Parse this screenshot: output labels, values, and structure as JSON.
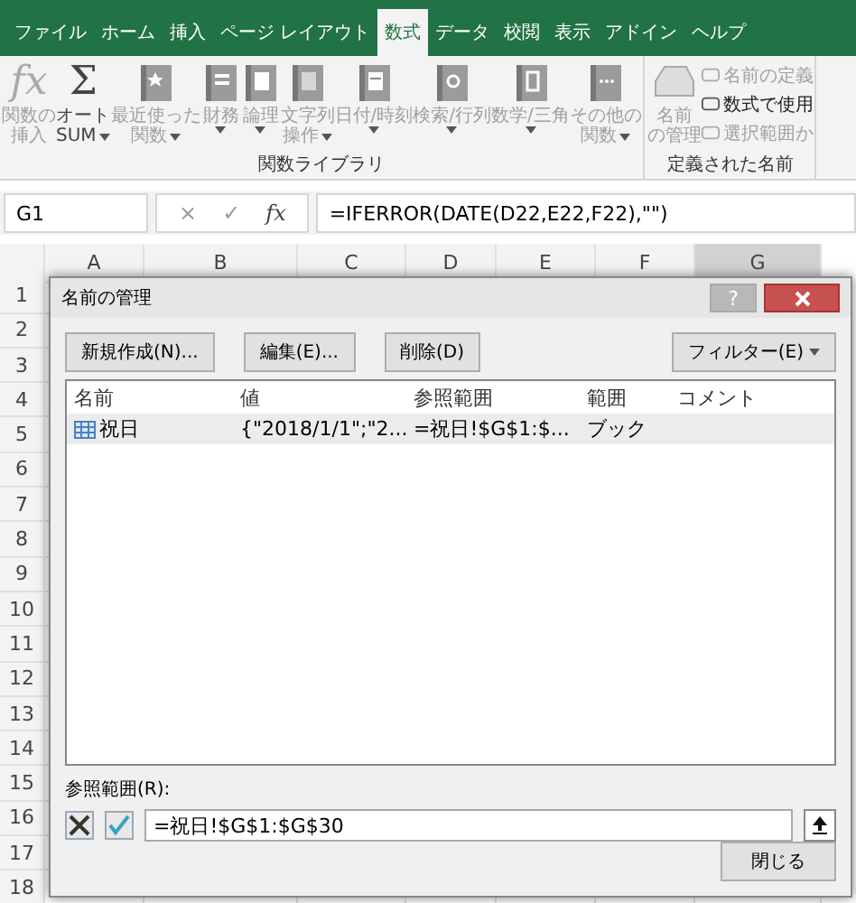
{
  "ribbon": {
    "tabs": [
      {
        "label": "ファイル",
        "selected": false
      },
      {
        "label": "ホーム",
        "selected": false
      },
      {
        "label": "挿入",
        "selected": false
      },
      {
        "label": "ページ レイアウト",
        "selected": false
      },
      {
        "label": "数式",
        "selected": true
      },
      {
        "label": "データ",
        "selected": false
      },
      {
        "label": "校閲",
        "selected": false
      },
      {
        "label": "表示",
        "selected": false
      },
      {
        "label": "アドイン",
        "selected": false
      },
      {
        "label": "ヘルプ",
        "selected": false
      }
    ],
    "groups": [
      {
        "label": "関数ライブラリ",
        "items": [
          {
            "kind": "large",
            "glyph": "fx",
            "lines": [
              "関数の",
              "挿入"
            ],
            "dropdown": false,
            "disabled": true
          },
          {
            "kind": "large",
            "glyph": "Σ",
            "lines": [
              "オート",
              "SUM"
            ],
            "dropdown": true,
            "disabled": false
          },
          {
            "kind": "large",
            "lines": [
              "最近使った",
              "関数"
            ],
            "dropdown": true,
            "disabled": true
          },
          {
            "kind": "large",
            "lines": [
              "財務"
            ],
            "dropdown": true,
            "disabled": true
          },
          {
            "kind": "large",
            "lines": [
              "論理"
            ],
            "dropdown": true,
            "disabled": true
          },
          {
            "kind": "large",
            "lines": [
              "文字列",
              "操作"
            ],
            "dropdown": true,
            "disabled": true
          },
          {
            "kind": "large",
            "lines": [
              "日付/時刻"
            ],
            "dropdown": true,
            "disabled": true
          },
          {
            "kind": "large",
            "lines": [
              "検索/行列"
            ],
            "dropdown": true,
            "disabled": true
          },
          {
            "kind": "large",
            "lines": [
              "数学/三角"
            ],
            "dropdown": true,
            "disabled": true
          },
          {
            "kind": "large",
            "lines": [
              "その他の",
              "関数"
            ],
            "dropdown": true,
            "disabled": true
          }
        ]
      },
      {
        "label": "定義された名前",
        "items": [
          {
            "kind": "large",
            "lines": [
              "名前",
              "の管理"
            ],
            "dropdown": false,
            "disabled": true
          },
          {
            "kind": "small",
            "lines": [
              "名前の定義"
            ],
            "disabled": true
          },
          {
            "kind": "small",
            "lines": [
              "数式で使用"
            ],
            "disabled": false
          },
          {
            "kind": "small",
            "lines": [
              "選択範囲か"
            ],
            "disabled": true
          }
        ]
      }
    ]
  },
  "formula_bar": {
    "name_box": "G1",
    "cancel": "×",
    "enter": "✓",
    "function_button": "fx",
    "formula": "=IFERROR(DATE(D22,E22,F22),\"\")"
  },
  "sheet": {
    "columns": [
      {
        "label": "A",
        "selected": false
      },
      {
        "label": "B",
        "selected": false
      },
      {
        "label": "C",
        "selected": false
      },
      {
        "label": "D",
        "selected": false
      },
      {
        "label": "E",
        "selected": false
      },
      {
        "label": "F",
        "selected": false
      },
      {
        "label": "G",
        "selected": true
      }
    ],
    "rows": [
      "1",
      "2",
      "3",
      "4",
      "5",
      "6",
      "7",
      "8",
      "9",
      "10",
      "11",
      "12",
      "13",
      "14",
      "15",
      "16",
      "17",
      "18"
    ]
  },
  "dialog": {
    "title": "名前の管理",
    "help": "?",
    "buttons": [
      "新規作成(N)...",
      "編集(E)...",
      "削除(D)"
    ],
    "filter": "フィルター(E)",
    "columns": [
      "名前",
      "値",
      "参照範囲",
      "範囲",
      "コメント"
    ],
    "rows": [
      {
        "name": "祝日",
        "value": "{\"2018/1/1\";\"2...",
        "refers_to": "=祝日!$G$1:$...",
        "scope": "ブック",
        "selected": true
      }
    ],
    "ref_label": "参照範囲(R):",
    "ref_value": "=祝日!$G$1:$G$30",
    "close": "閉じる"
  }
}
